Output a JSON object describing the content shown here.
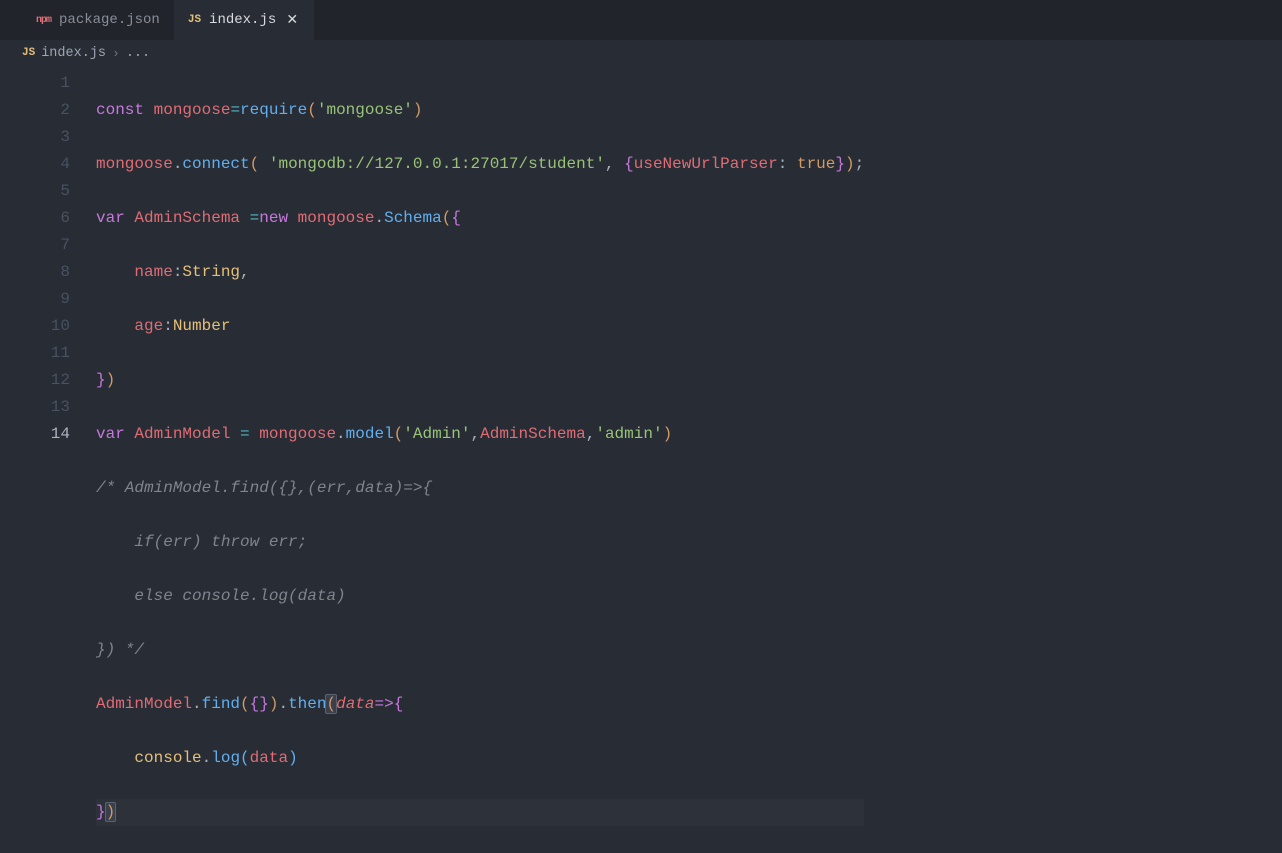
{
  "tabs": [
    {
      "icon": "npm",
      "label": "package.json",
      "active": false,
      "close": false
    },
    {
      "icon": "JS",
      "label": "index.js",
      "active": true,
      "close": true
    }
  ],
  "breadcrumb": {
    "icon": "JS",
    "file": "index.js",
    "sep": "›",
    "rest": "..."
  },
  "lineNumbers": [
    "1",
    "2",
    "3",
    "4",
    "5",
    "6",
    "7",
    "8",
    "9",
    "10",
    "11",
    "12",
    "13",
    "14"
  ],
  "activeLine": 14,
  "code": {
    "l1": {
      "const": "const",
      "sp": " ",
      "mongoose": "mongoose",
      "eq": "=",
      "require": "require",
      "open": "(",
      "str": "'mongoose'",
      "close": ")"
    },
    "l2": {
      "mongoose": "mongoose",
      "dot": ".",
      "connect": "connect",
      "open": "(",
      "sp": " ",
      "str": "'mongodb://127.0.0.1:27017/student'",
      "comma": ", ",
      "brace": "{",
      "key": "useNewUrlParser",
      "colon": ": ",
      "true": "true",
      "brace2": "}",
      "close": ")",
      "semi": ";"
    },
    "l3": {
      "var": "var",
      "name": " AdminSchema ",
      "eq": "=",
      "new": "new",
      "sp": " ",
      "mongoose": "mongoose",
      "dot": ".",
      "Schema": "Schema",
      "open": "(",
      "brace": "{"
    },
    "l4": {
      "indent": "    ",
      "key": "name",
      "colon": ":",
      "type": "String",
      "comma": ","
    },
    "l5": {
      "indent": "    ",
      "key": "age",
      "colon": ":",
      "type": "Number"
    },
    "l6": {
      "brace": "}",
      "close": ")"
    },
    "l7": {
      "var": "var",
      "name": " AdminModel ",
      "eq": "= ",
      "mongoose": "mongoose",
      "dot": ".",
      "model": "model",
      "open": "(",
      "s1": "'Admin'",
      "c1": ",",
      "arg": "AdminSchema",
      "c2": ",",
      "s2": "'admin'",
      "close": ")"
    },
    "l8": {
      "txt": "/* AdminModel.find({},(err,data)=>{"
    },
    "l9": {
      "txt": "    if(err) throw err;"
    },
    "l10": {
      "txt": "    else console.log(data)"
    },
    "l11": {
      "txt": "}) */"
    },
    "l12": {
      "AdminModel": "AdminModel",
      "dot": ".",
      "find": "find",
      "o1": "(",
      "b1": "{",
      "b2": "}",
      "c1": ")",
      "dot2": ".",
      "then": "then",
      "o2": "(",
      "data": "data",
      "arrow": "=>",
      "b3": "{"
    },
    "l13": {
      "indent": "    ",
      "console": "console",
      "dot": ".",
      "log": "log",
      "open": "(",
      "data": "data",
      "close": ")"
    },
    "l14": {
      "b": "}",
      "c": ")"
    }
  }
}
